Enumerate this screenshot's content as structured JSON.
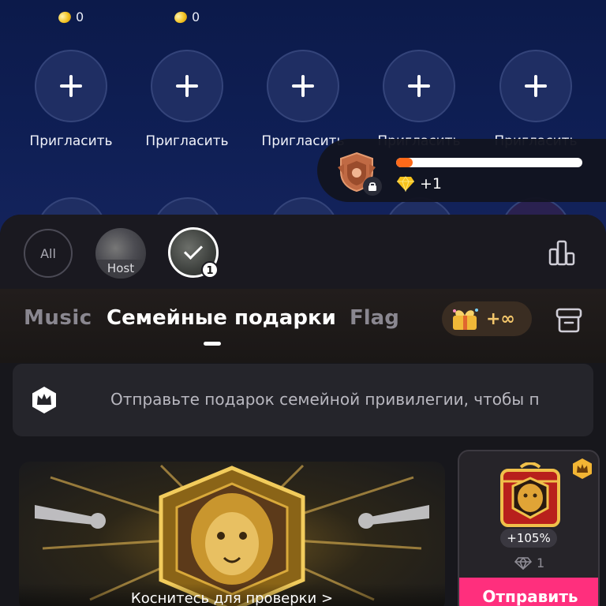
{
  "top": {
    "coin_counts": [
      "0",
      "0"
    ],
    "seats": [
      {
        "label": "Пригласить"
      },
      {
        "label": "Пригласить"
      },
      {
        "label": "Пригласить"
      },
      {
        "label": "Пригласить"
      },
      {
        "label": "Пригласить"
      }
    ]
  },
  "level": {
    "progress": 0.09,
    "gem_reward": "+1",
    "accent_color": "#ff6a1a"
  },
  "recipients": {
    "all_label": "All",
    "host_label": "Host",
    "selected_count": "1"
  },
  "tabs": {
    "items": [
      "Music",
      "Семейные подарки",
      "Flag"
    ],
    "active": "Семейные подарки",
    "infinity_label": "+∞"
  },
  "notice": {
    "text": "Отправьте подарок семейной привилегии, чтобы п"
  },
  "banner": {
    "caption": "Коснитесь для проверки >"
  },
  "gift": {
    "bonus": "+105%",
    "price": "1",
    "send_label": "Отправить",
    "send_color": "#ff2f7d"
  }
}
